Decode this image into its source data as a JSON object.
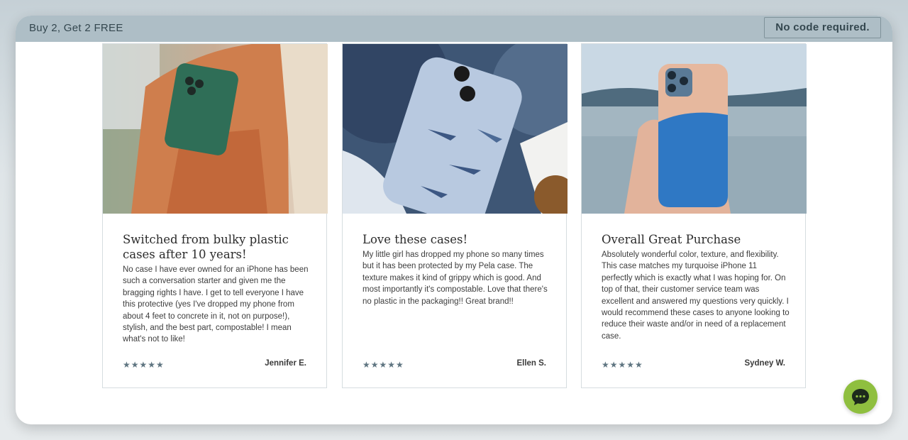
{
  "banner": {
    "promo": "Buy 2, Get 2 FREE",
    "code_note": "No code required."
  },
  "reviews": [
    {
      "title": "Switched from bulky plastic cases after 10 years!",
      "body": "No case I have ever owned for an iPhone has been such a conversation starter and given me the bragging rights I have. I get to tell everyone I have this protective (yes I've dropped my phone from about 4 feet to concrete in it, not on purpose!), stylish, and the best part, compostable! I mean what's not to like!",
      "stars": "★★★★★",
      "author": "Jennifer E.",
      "image": "green-phone-case-in-backpack"
    },
    {
      "title": "Love these cases!",
      "body": "My little girl has dropped my phone so many times but it has been protected by my Pela case. The texture makes it kind of grippy which is good. And most importantly it's compostable. Love that there's no plastic in the packaging!! Great brand!!",
      "stars": "★★★★★",
      "author": "Ellen S.",
      "image": "shark-print-phone-case"
    },
    {
      "title": "Overall Great Purchase",
      "body": "Absolutely wonderful color, texture, and flexibility. This case matches my turquoise iPhone 11 perfectly which is exactly what I was hoping for. On top of that, their customer service team was excellent and answered my questions very quickly. I would recommend these cases to anyone looking to reduce their waste and/or in need of a replacement case.",
      "stars": "★★★★★",
      "author": "Sydney W.",
      "image": "ocean-wave-phone-case-held-by-lake"
    }
  ],
  "chat": {
    "icon": "chat-bubble-icon"
  },
  "colors": {
    "banner_bg": "#aebec6",
    "star": "#5f7581",
    "chat_bg": "#8fbf3f"
  }
}
